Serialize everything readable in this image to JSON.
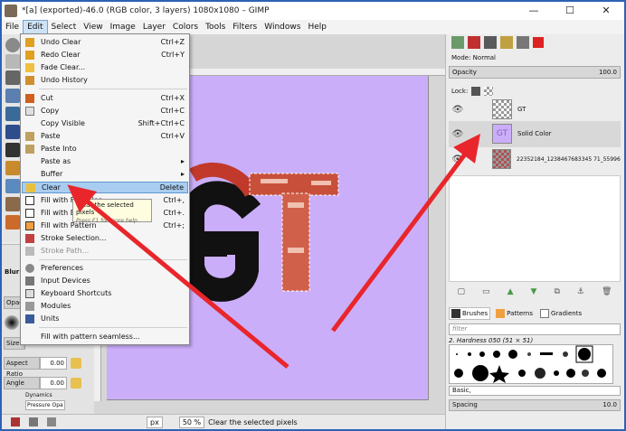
{
  "window": {
    "title": "*[a] (exported)-46.0 (RGB color, 3 layers) 1080x1080 – GIMP",
    "minimize": "—",
    "maximize": "☐",
    "close": "✕"
  },
  "menubar": [
    "File",
    "Edit",
    "Select",
    "View",
    "Image",
    "Layer",
    "Colors",
    "Tools",
    "Filters",
    "Windows",
    "Help"
  ],
  "edit_menu": {
    "items": [
      {
        "label": "Undo Clear",
        "shortcut": "Ctrl+Z",
        "icon": "undo-icon"
      },
      {
        "label": "Redo Clear",
        "shortcut": "Ctrl+Y",
        "icon": "redo-icon"
      },
      {
        "label": "Fade Clear...",
        "shortcut": "",
        "icon": "fade-icon"
      },
      {
        "label": "Undo History",
        "shortcut": "",
        "icon": "history-icon"
      },
      {
        "label": "Cut",
        "shortcut": "Ctrl+X",
        "icon": "cut-icon"
      },
      {
        "label": "Copy",
        "shortcut": "Ctrl+C",
        "icon": "copy-icon"
      },
      {
        "label": "Copy Visible",
        "shortcut": "Shift+Ctrl+C",
        "icon": ""
      },
      {
        "label": "Paste",
        "shortcut": "Ctrl+V",
        "icon": "paste-icon"
      },
      {
        "label": "Paste Into",
        "shortcut": "",
        "icon": "paste-into-icon"
      },
      {
        "label": "Paste as",
        "shortcut": "▸",
        "icon": ""
      },
      {
        "label": "Buffer",
        "shortcut": "▸",
        "icon": ""
      },
      {
        "label": "Clear",
        "shortcut": "Delete",
        "icon": "clear-icon"
      },
      {
        "label": "Fill with FG Color",
        "shortcut": "Ctrl+,",
        "icon": "fg-fill-icon"
      },
      {
        "label": "Fill with BG Color",
        "shortcut": "Ctrl+.",
        "icon": "bg-fill-icon"
      },
      {
        "label": "Fill with Pattern",
        "shortcut": "Ctrl+;",
        "icon": "pattern-fill-icon"
      },
      {
        "label": "Stroke Selection...",
        "shortcut": "",
        "icon": "stroke-selection-icon"
      },
      {
        "label": "Stroke Path...",
        "shortcut": "",
        "icon": "stroke-path-icon"
      },
      {
        "label": "Preferences",
        "shortcut": "",
        "icon": "preferences-icon"
      },
      {
        "label": "Input Devices",
        "shortcut": "",
        "icon": "input-devices-icon"
      },
      {
        "label": "Keyboard Shortcuts",
        "shortcut": "",
        "icon": "keyboard-icon"
      },
      {
        "label": "Modules",
        "shortcut": "",
        "icon": "modules-icon"
      },
      {
        "label": "Units",
        "shortcut": "",
        "icon": "units-icon"
      },
      {
        "label": "Fill with pattern seamless...",
        "shortcut": "",
        "icon": ""
      }
    ]
  },
  "tooltip": {
    "text": "Clear the selected pixels",
    "hint": "Press F1 for more help"
  },
  "tool_options": {
    "title": "Blur / Sharpen",
    "opacity_label": "Opacity",
    "size_label": "Size",
    "aspect_label": "Aspect Ratio",
    "aspect_value": "0.00",
    "angle_label": "Angle",
    "angle_value": "0.00",
    "dynamics_label": "Dynamics",
    "dynamics_value": "Pressure Opa"
  },
  "canvas": {
    "text": "GT",
    "background": "#cbaefa"
  },
  "statusbar": {
    "unit": "px",
    "zoom": "50 %",
    "message": "Clear the selected pixels"
  },
  "layers": {
    "mode_label": "Mode",
    "mode_value": "Normal",
    "opacity_label": "Opacity",
    "opacity_value": "100.0",
    "lock_label": "Lock:",
    "items": [
      {
        "name": "GT"
      },
      {
        "name": "Solid Color"
      },
      {
        "name": "22352184_1238467683345 71_559960799..."
      }
    ]
  },
  "brushes": {
    "tabs": [
      "Brushes",
      "Patterns",
      "Gradients"
    ],
    "filter_placeholder": "filter",
    "current_brush": "2. Hardness 050 (51 × 51)",
    "preset": "Basic,",
    "spacing_label": "Spacing",
    "spacing_value": "10.0"
  },
  "colors": {
    "accent": "#2d62b5",
    "highlight": "#a9cdf1",
    "arrow": "#e8262b",
    "canvas_bg": "#cbaefa"
  }
}
